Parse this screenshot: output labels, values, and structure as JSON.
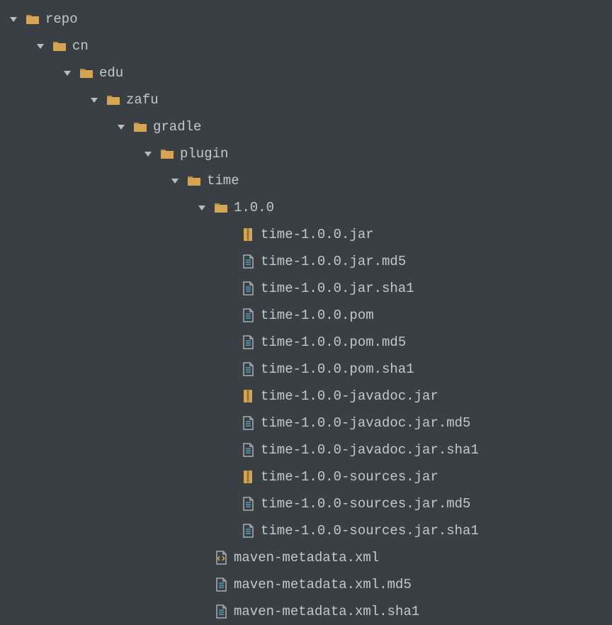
{
  "tree": [
    {
      "depth": 0,
      "expanded": true,
      "icon": "folder",
      "label": "repo"
    },
    {
      "depth": 1,
      "expanded": true,
      "icon": "folder",
      "label": "cn"
    },
    {
      "depth": 2,
      "expanded": true,
      "icon": "folder",
      "label": "edu"
    },
    {
      "depth": 3,
      "expanded": true,
      "icon": "folder",
      "label": "zafu"
    },
    {
      "depth": 4,
      "expanded": true,
      "icon": "folder",
      "label": "gradle"
    },
    {
      "depth": 5,
      "expanded": true,
      "icon": "folder",
      "label": "plugin"
    },
    {
      "depth": 6,
      "expanded": true,
      "icon": "folder",
      "label": "time"
    },
    {
      "depth": 7,
      "expanded": true,
      "icon": "folder",
      "label": "1.0.0"
    },
    {
      "depth": 8,
      "expanded": null,
      "icon": "archive",
      "label": "time-1.0.0.jar"
    },
    {
      "depth": 8,
      "expanded": null,
      "icon": "file",
      "label": "time-1.0.0.jar.md5"
    },
    {
      "depth": 8,
      "expanded": null,
      "icon": "file",
      "label": "time-1.0.0.jar.sha1"
    },
    {
      "depth": 8,
      "expanded": null,
      "icon": "file",
      "label": "time-1.0.0.pom"
    },
    {
      "depth": 8,
      "expanded": null,
      "icon": "file",
      "label": "time-1.0.0.pom.md5"
    },
    {
      "depth": 8,
      "expanded": null,
      "icon": "file",
      "label": "time-1.0.0.pom.sha1"
    },
    {
      "depth": 8,
      "expanded": null,
      "icon": "archive",
      "label": "time-1.0.0-javadoc.jar"
    },
    {
      "depth": 8,
      "expanded": null,
      "icon": "file",
      "label": "time-1.0.0-javadoc.jar.md5"
    },
    {
      "depth": 8,
      "expanded": null,
      "icon": "file",
      "label": "time-1.0.0-javadoc.jar.sha1"
    },
    {
      "depth": 8,
      "expanded": null,
      "icon": "archive",
      "label": "time-1.0.0-sources.jar"
    },
    {
      "depth": 8,
      "expanded": null,
      "icon": "file",
      "label": "time-1.0.0-sources.jar.md5"
    },
    {
      "depth": 8,
      "expanded": null,
      "icon": "file",
      "label": "time-1.0.0-sources.jar.sha1"
    },
    {
      "depth": 7,
      "expanded": null,
      "icon": "xml",
      "label": "maven-metadata.xml"
    },
    {
      "depth": 7,
      "expanded": null,
      "icon": "file",
      "label": "maven-metadata.xml.md5"
    },
    {
      "depth": 7,
      "expanded": null,
      "icon": "file",
      "label": "maven-metadata.xml.sha1"
    }
  ],
  "colors": {
    "folder": "#d6a552",
    "archive_fill": "#d6a552",
    "file_outline": "#a7adb3",
    "file_accent": "#4da2c9",
    "arrow": "#b8bcc0",
    "xml_accent": "#d6a552"
  }
}
